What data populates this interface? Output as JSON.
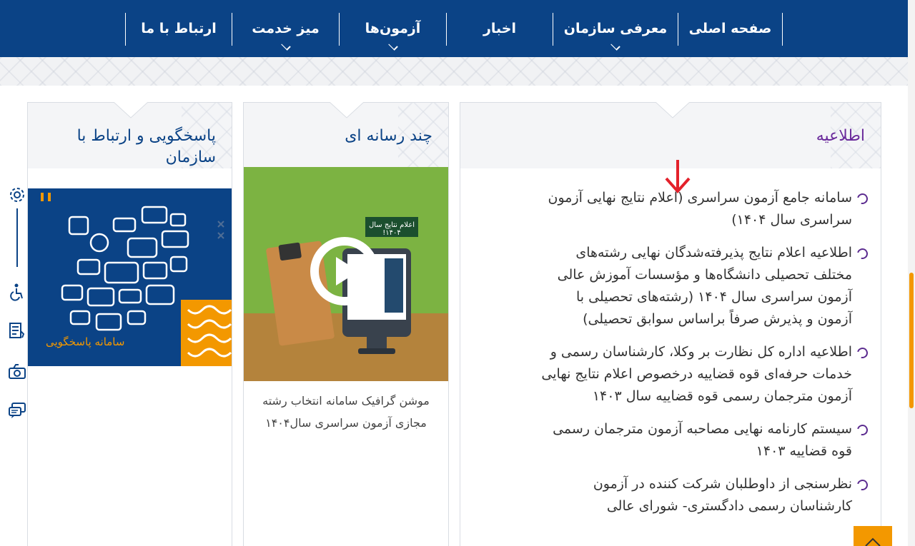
{
  "nav": {
    "items": [
      {
        "label": "صفحه اصلی",
        "has_submenu": false
      },
      {
        "label": "معرفی سازمان",
        "has_submenu": true
      },
      {
        "label": "اخبار",
        "has_submenu": false
      },
      {
        "label": "آزمون‌ها",
        "has_submenu": true
      },
      {
        "label": "میز خدمت",
        "has_submenu": true
      },
      {
        "label": "ارتباط با ما",
        "has_submenu": false
      }
    ]
  },
  "side_tools": {
    "icons": [
      "gear-icon",
      "accessibility-icon",
      "checklist-icon",
      "camera-icon",
      "chat-icon"
    ]
  },
  "announcements": {
    "title": "اطلاعیه",
    "items": [
      "سامانه جامع آزمون سراسری (اعلام نتایج نهایی آزمون سراسری سال ۱۴۰۴)",
      "اطلاعیه اعلام نتایج پذیرفته‌شدگان نهایی رشته‌های مختلف تحصیلی دانشگاه‌ها و مؤسسات آموزش عالی آزمون سراسری سال ۱۴۰۴ (رشته‌های تحصیلی با آزمون و پذیرش صرفاً براساس سوابق تحصیلی)",
      "اطلاعیه اداره کل نظارت بر وکلا، کارشناسان رسمی و خدمات حرفه‌ای قوه قضاییه درخصوص اعلام نتایج نهایی آزمون مترجمان رسمی قوه قضاییه سال ۱۴۰۳",
      "سیستم کارنامه نهایی مصاحبه آزمون مترجمان رسمی قوه قضاییه ۱۴۰۳",
      "نظرسنجی از داوطلبان شرکت کننده در آزمون کارشناسان رسمی دادگستری- شورای عالی"
    ]
  },
  "media": {
    "title": "چند رسانه ای",
    "sign_text": "اعلام نتایج سال ۱۴۰۴!",
    "caption": "موشن گرافیک سامانه انتخاب رشته مجازی آزمون سراسری سال۱۴۰۴"
  },
  "support": {
    "title": "پاسخگویی و ارتباط با سازمان",
    "image_caption": "سامانه پاسخگویی"
  },
  "colors": {
    "nav_bg": "#0b4386",
    "accent": "#f39800",
    "bullet": "#5b2b8f",
    "title": "#0b4386"
  }
}
